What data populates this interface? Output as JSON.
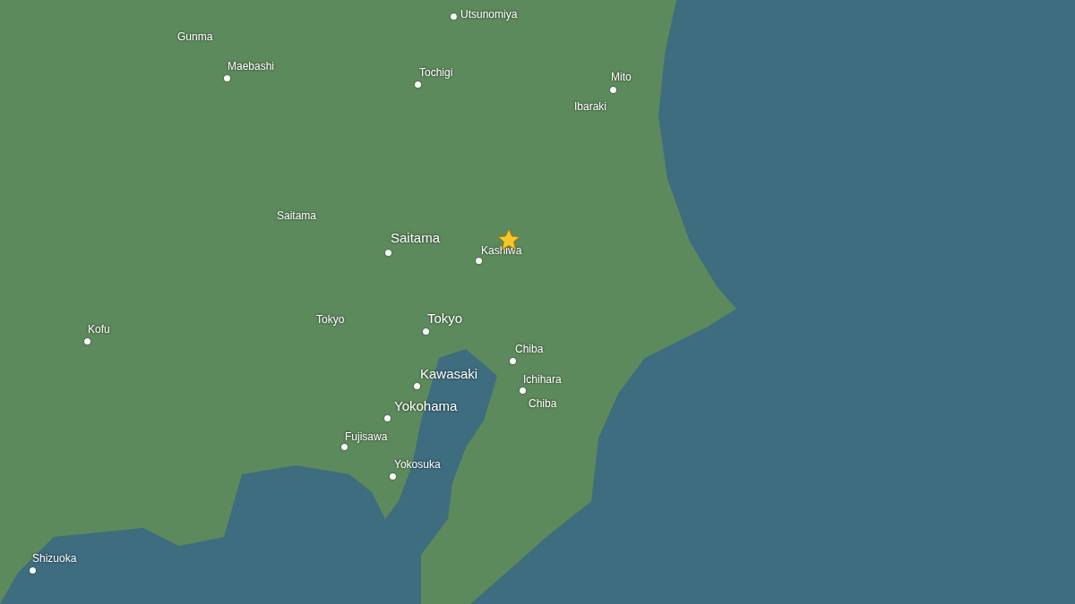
{
  "map": {
    "places": [
      {
        "name": "Utsunomiya",
        "kind": "minor"
      },
      {
        "name": "Gunma",
        "kind": "area"
      },
      {
        "name": "Maebashi",
        "kind": "minor"
      },
      {
        "name": "Tochigi",
        "kind": "minor"
      },
      {
        "name": "Mito",
        "kind": "minor"
      },
      {
        "name": "Ibaraki",
        "kind": "area"
      },
      {
        "name": "Saitama",
        "kind": "area"
      },
      {
        "name": "Saitama",
        "kind": "major"
      },
      {
        "name": "Kashiwa",
        "kind": "minor"
      },
      {
        "name": "Kofu",
        "kind": "minor"
      },
      {
        "name": "Tokyo",
        "kind": "area"
      },
      {
        "name": "Tokyo",
        "kind": "major"
      },
      {
        "name": "Chiba",
        "kind": "minor"
      },
      {
        "name": "Kawasaki",
        "kind": "major"
      },
      {
        "name": "Ichihara",
        "kind": "minor"
      },
      {
        "name": "Chiba",
        "kind": "area"
      },
      {
        "name": "Yokohama",
        "kind": "major"
      },
      {
        "name": "Fujisawa",
        "kind": "minor"
      },
      {
        "name": "Yokosuka",
        "kind": "minor"
      },
      {
        "name": "Shizuoka",
        "kind": "minor"
      }
    ],
    "marker": {
      "kind": "star"
    }
  }
}
